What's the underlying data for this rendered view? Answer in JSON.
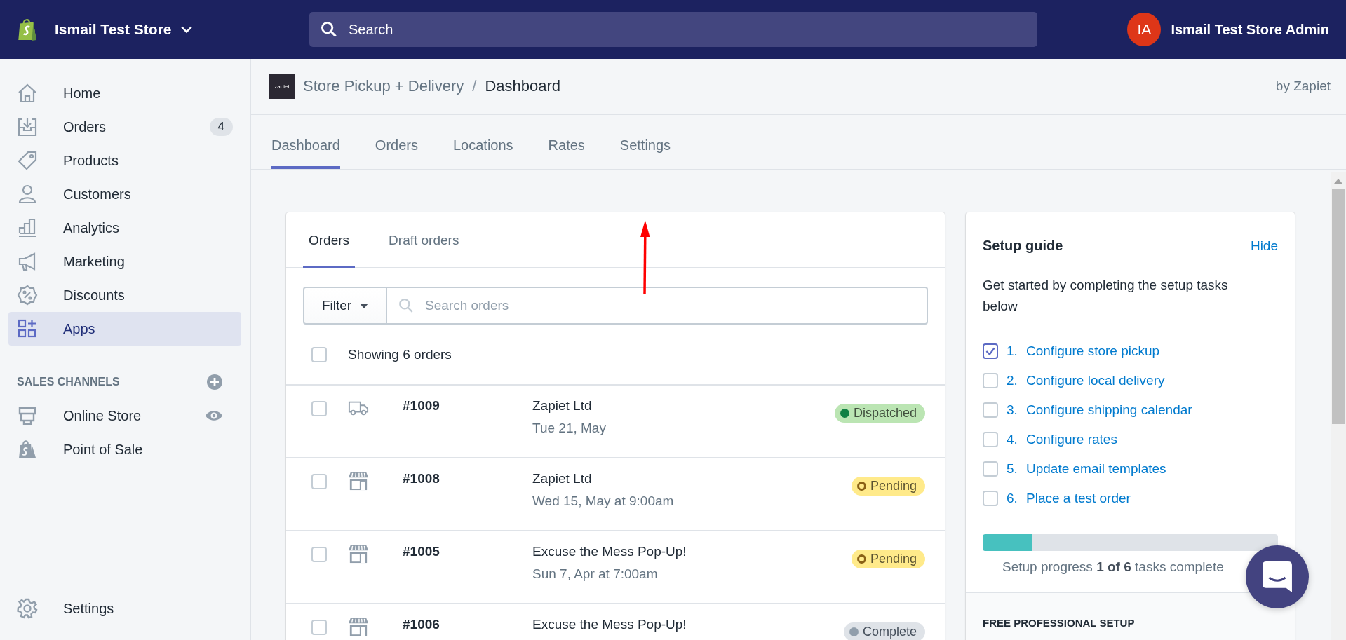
{
  "top_bar": {
    "store_name": "Ismail Test Store",
    "search": {
      "placeholder": "Search"
    },
    "avatar_initials": "IA",
    "user_name": "Ismail Test Store Admin"
  },
  "sidebar": {
    "items": [
      {
        "label": "Home",
        "selected": false
      },
      {
        "label": "Orders",
        "selected": false,
        "badge": "4"
      },
      {
        "label": "Products",
        "selected": false
      },
      {
        "label": "Customers",
        "selected": false
      },
      {
        "label": "Analytics",
        "selected": false
      },
      {
        "label": "Marketing",
        "selected": false
      },
      {
        "label": "Discounts",
        "selected": false
      },
      {
        "label": "Apps",
        "selected": true
      }
    ],
    "sales_channels": {
      "heading": "SALES CHANNELS",
      "items": [
        {
          "label": "Online Store"
        },
        {
          "label": "Point of Sale"
        }
      ]
    },
    "settings": {
      "label": "Settings"
    }
  },
  "app_header": {
    "logo_text": "zapiet",
    "breadcrumb": "Store Pickup + Delivery",
    "separator": "/",
    "page": "Dashboard",
    "vendor": "by Zapiet"
  },
  "tabs": [
    {
      "label": "Dashboard",
      "selected": true
    },
    {
      "label": "Orders",
      "selected": false
    },
    {
      "label": "Locations",
      "selected": false
    },
    {
      "label": "Rates",
      "selected": false
    },
    {
      "label": "Settings",
      "selected": false
    }
  ],
  "orders_card": {
    "tabs": [
      {
        "label": "Orders",
        "selected": true
      },
      {
        "label": "Draft orders",
        "selected": false
      }
    ],
    "filter": "Filter",
    "search": {
      "placeholder": "Search orders"
    },
    "select_all": {
      "checked": false,
      "label": "Showing 6 orders"
    },
    "rows": [
      {
        "checked": false,
        "kind": "delivery",
        "number": "#1009",
        "customer": "Zapiet Ltd",
        "date": "Tue 21, May",
        "status": {
          "kind": "dispatched",
          "label": "Dispatched"
        }
      },
      {
        "checked": false,
        "kind": "pickup",
        "number": "#1008",
        "customer": "Zapiet Ltd",
        "date": "Wed 15, May at 9:00am",
        "status": {
          "kind": "pending",
          "label": "Pending"
        }
      },
      {
        "checked": false,
        "kind": "pickup",
        "number": "#1005",
        "customer": "Excuse the Mess Pop-Up!",
        "date": "Sun 7, Apr at 7:00am",
        "status": {
          "kind": "pending",
          "label": "Pending"
        }
      },
      {
        "checked": false,
        "kind": "pickup",
        "number": "#1006",
        "customer": "Excuse the Mess Pop-Up!",
        "status": {
          "kind": "complete",
          "label": "Complete"
        }
      }
    ]
  },
  "setup_guide": {
    "title": "Setup guide",
    "hide": "Hide",
    "description": "Get started by completing the setup tasks below",
    "tasks": [
      {
        "number": "1.",
        "label": "Configure store pickup",
        "checked": true
      },
      {
        "number": "2.",
        "label": "Configure local delivery",
        "checked": false
      },
      {
        "number": "3.",
        "label": "Configure shipping calendar",
        "checked": false
      },
      {
        "number": "4.",
        "label": "Configure rates",
        "checked": false
      },
      {
        "number": "5.",
        "label": "Update email templates",
        "checked": false
      },
      {
        "number": "6.",
        "label": "Place a test order",
        "checked": false
      }
    ],
    "progress": {
      "level": 0.167,
      "text": "Setup progress **1 of 6** tasks complete"
    },
    "footer_heading": "FREE PROFESSIONAL SETUP"
  }
}
